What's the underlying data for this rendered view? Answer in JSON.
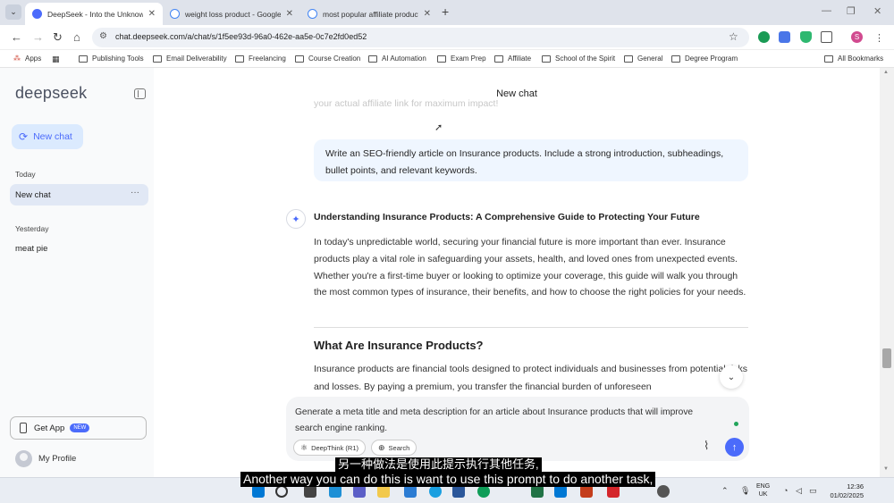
{
  "browser": {
    "tabs": [
      {
        "title": "DeepSeek - Into the Unknown",
        "active": true
      },
      {
        "title": "weight loss product - Google S",
        "active": false
      },
      {
        "title": "most popular affiliate products",
        "active": false
      }
    ],
    "url": "chat.deepseek.com/a/chat/s/1f5ee93d-96a0-462e-aa5e-0c7e2fd0ed52",
    "profile_initial": "S",
    "bookmarks": [
      "Apps",
      "Publishing Tools",
      "Email Deliverability",
      "Freelancing",
      "Course Creation",
      "AI Automation",
      "Exam Prep",
      "Affiliate",
      "School of the Spirit",
      "General",
      "Degree Program"
    ],
    "all_bookmarks": "All Bookmarks"
  },
  "sidebar": {
    "logo": "deepseek",
    "new_chat": "New chat",
    "today_label": "Today",
    "today_items": [
      "New chat"
    ],
    "yesterday_label": "Yesterday",
    "yesterday_items": [
      "meat pie"
    ],
    "get_app": "Get App",
    "get_app_badge": "NEW",
    "my_profile": "My Profile"
  },
  "main": {
    "title": "New chat",
    "faded_line": "your actual affiliate link for maximum impact!",
    "user_message": "Write an SEO-friendly article on Insurance products. Include a strong introduction, subheadings, bullet points, and relevant keywords.",
    "ai_heading": "Understanding Insurance Products: A Comprehensive Guide to Protecting Your Future",
    "ai_intro": "In today's unpredictable world, securing your financial future is more important than ever. Insurance products play a vital role in safeguarding your assets, health, and loved ones from unexpected events. Whether you're a first-time buyer or looking to optimize your coverage, this guide will walk you through the most common types of insurance, their benefits, and how to choose the right policies for your needs.",
    "ai_subheading": "What Are Insurance Products?",
    "ai_body": "Insurance products are financial tools designed to protect individuals and businesses from potential risks and losses. By paying a premium, you transfer the financial burden of unforeseen"
  },
  "composer": {
    "text": "Generate a meta title and meta description for an article about Insurance products that will improve search engine ranking.",
    "deepthink": "DeepThink (R1)",
    "search": "Search"
  },
  "taskbar": {
    "lang_line1": "ENG",
    "lang_line2": "UK",
    "time": "12:36",
    "date": "01/02/2025"
  },
  "subtitles": {
    "chinese": "另一种做法是使用此提示执行其他任务,",
    "english": "Another way you can do this is want to use this prompt to do another task,"
  },
  "colors": {
    "accent": "#4b6bfb",
    "user_bubble": "#eff6ff",
    "sidebar_bg": "#f9fafb"
  }
}
